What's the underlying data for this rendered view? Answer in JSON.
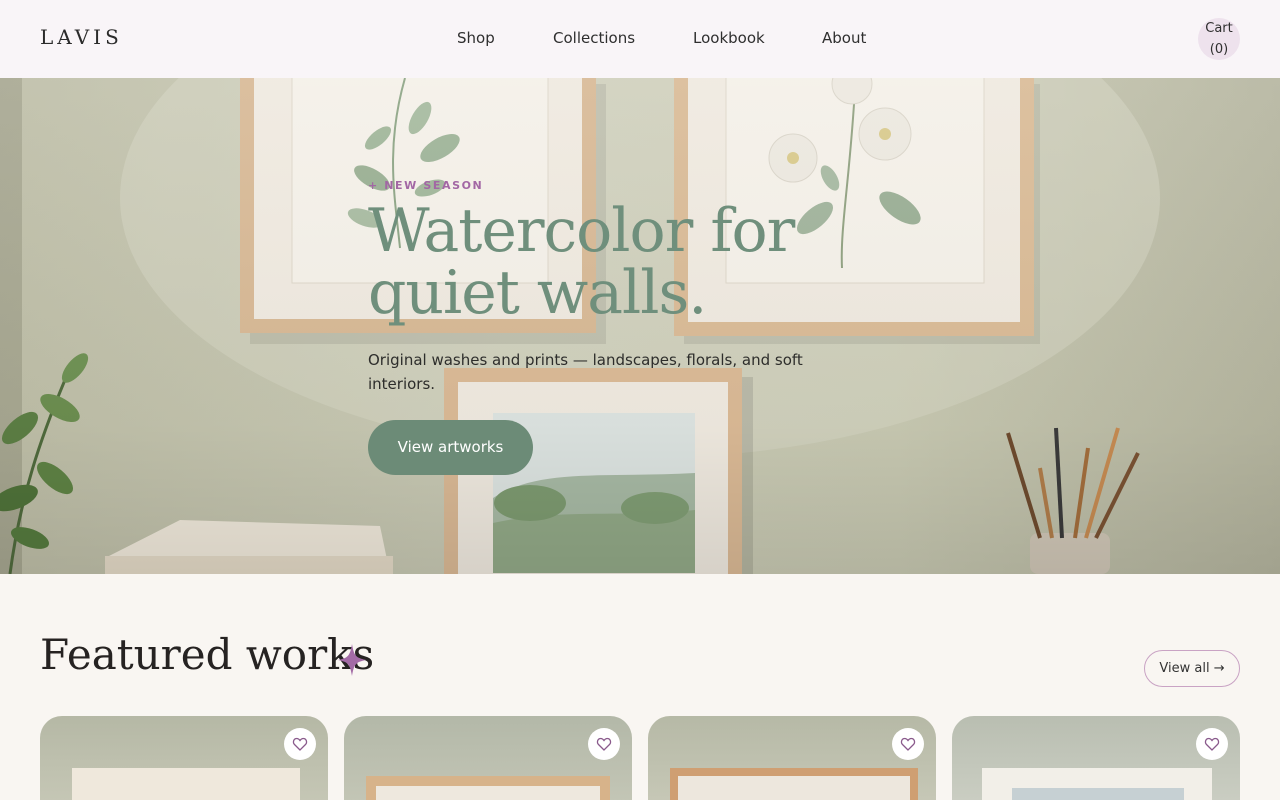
{
  "header": {
    "logo": "LAVIS",
    "nav": [
      "Shop",
      "Collections",
      "Lookbook",
      "About"
    ],
    "cart_label": "Cart (0)"
  },
  "hero": {
    "kicker": "+ NEW SEASON",
    "title": "Watercolor for quiet walls.",
    "subtitle": "Original washes and prints — landscapes, florals, and soft interiors.",
    "cta": "View artworks"
  },
  "featured": {
    "title": "Featured works",
    "view_all": "View all →",
    "cards": [
      {
        "icon": "heart-icon"
      },
      {
        "icon": "heart-icon"
      },
      {
        "icon": "heart-icon"
      },
      {
        "icon": "heart-icon"
      }
    ]
  },
  "colors": {
    "accent_green": "#6c8b77",
    "accent_purple": "#a267a4",
    "background": "#f9f6f2",
    "header_bg": "#f9f5f8"
  }
}
